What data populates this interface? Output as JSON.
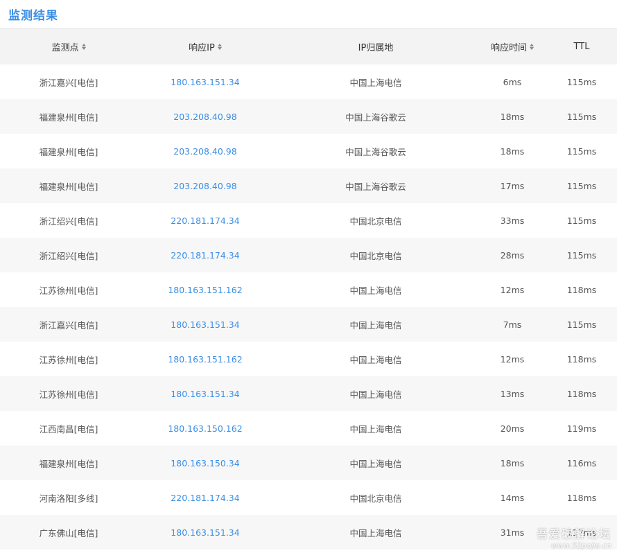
{
  "header": {
    "title": "监测结果"
  },
  "table": {
    "columns": [
      {
        "label": "监测点",
        "sortable": true
      },
      {
        "label": "响应IP",
        "sortable": true
      },
      {
        "label": "IP归属地",
        "sortable": false
      },
      {
        "label": "响应时间",
        "sortable": true
      },
      {
        "label": "TTL",
        "sortable": false
      }
    ],
    "rows": [
      {
        "point": "浙江嘉兴[电信]",
        "ip": "180.163.151.34",
        "location": "中国上海电信",
        "time": "6ms",
        "ttl": "115ms"
      },
      {
        "point": "福建泉州[电信]",
        "ip": "203.208.40.98",
        "location": "中国上海谷歌云",
        "time": "18ms",
        "ttl": "115ms"
      },
      {
        "point": "福建泉州[电信]",
        "ip": "203.208.40.98",
        "location": "中国上海谷歌云",
        "time": "18ms",
        "ttl": "115ms"
      },
      {
        "point": "福建泉州[电信]",
        "ip": "203.208.40.98",
        "location": "中国上海谷歌云",
        "time": "17ms",
        "ttl": "115ms"
      },
      {
        "point": "浙江绍兴[电信]",
        "ip": "220.181.174.34",
        "location": "中国北京电信",
        "time": "33ms",
        "ttl": "115ms"
      },
      {
        "point": "浙江绍兴[电信]",
        "ip": "220.181.174.34",
        "location": "中国北京电信",
        "time": "28ms",
        "ttl": "115ms"
      },
      {
        "point": "江苏徐州[电信]",
        "ip": "180.163.151.162",
        "location": "中国上海电信",
        "time": "12ms",
        "ttl": "118ms"
      },
      {
        "point": "浙江嘉兴[电信]",
        "ip": "180.163.151.34",
        "location": "中国上海电信",
        "time": "7ms",
        "ttl": "115ms"
      },
      {
        "point": "江苏徐州[电信]",
        "ip": "180.163.151.162",
        "location": "中国上海电信",
        "time": "12ms",
        "ttl": "118ms"
      },
      {
        "point": "江苏徐州[电信]",
        "ip": "180.163.151.34",
        "location": "中国上海电信",
        "time": "13ms",
        "ttl": "118ms"
      },
      {
        "point": "江西南昌[电信]",
        "ip": "180.163.150.162",
        "location": "中国上海电信",
        "time": "20ms",
        "ttl": "119ms"
      },
      {
        "point": "福建泉州[电信]",
        "ip": "180.163.150.34",
        "location": "中国上海电信",
        "time": "18ms",
        "ttl": "116ms"
      },
      {
        "point": "河南洛阳[多线]",
        "ip": "220.181.174.34",
        "location": "中国北京电信",
        "time": "14ms",
        "ttl": "118ms"
      },
      {
        "point": "广东佛山[电信]",
        "ip": "180.163.151.34",
        "location": "中国上海电信",
        "time": "31ms",
        "ttl": "117ms"
      }
    ]
  },
  "watermark": {
    "line1": "吾爱破解论坛",
    "line2": "www.52pojie.cn"
  },
  "colors": {
    "accent": "#3a8ee6",
    "header_bg": "#f3f3f3",
    "stripe_bg": "#f7f7f7"
  }
}
